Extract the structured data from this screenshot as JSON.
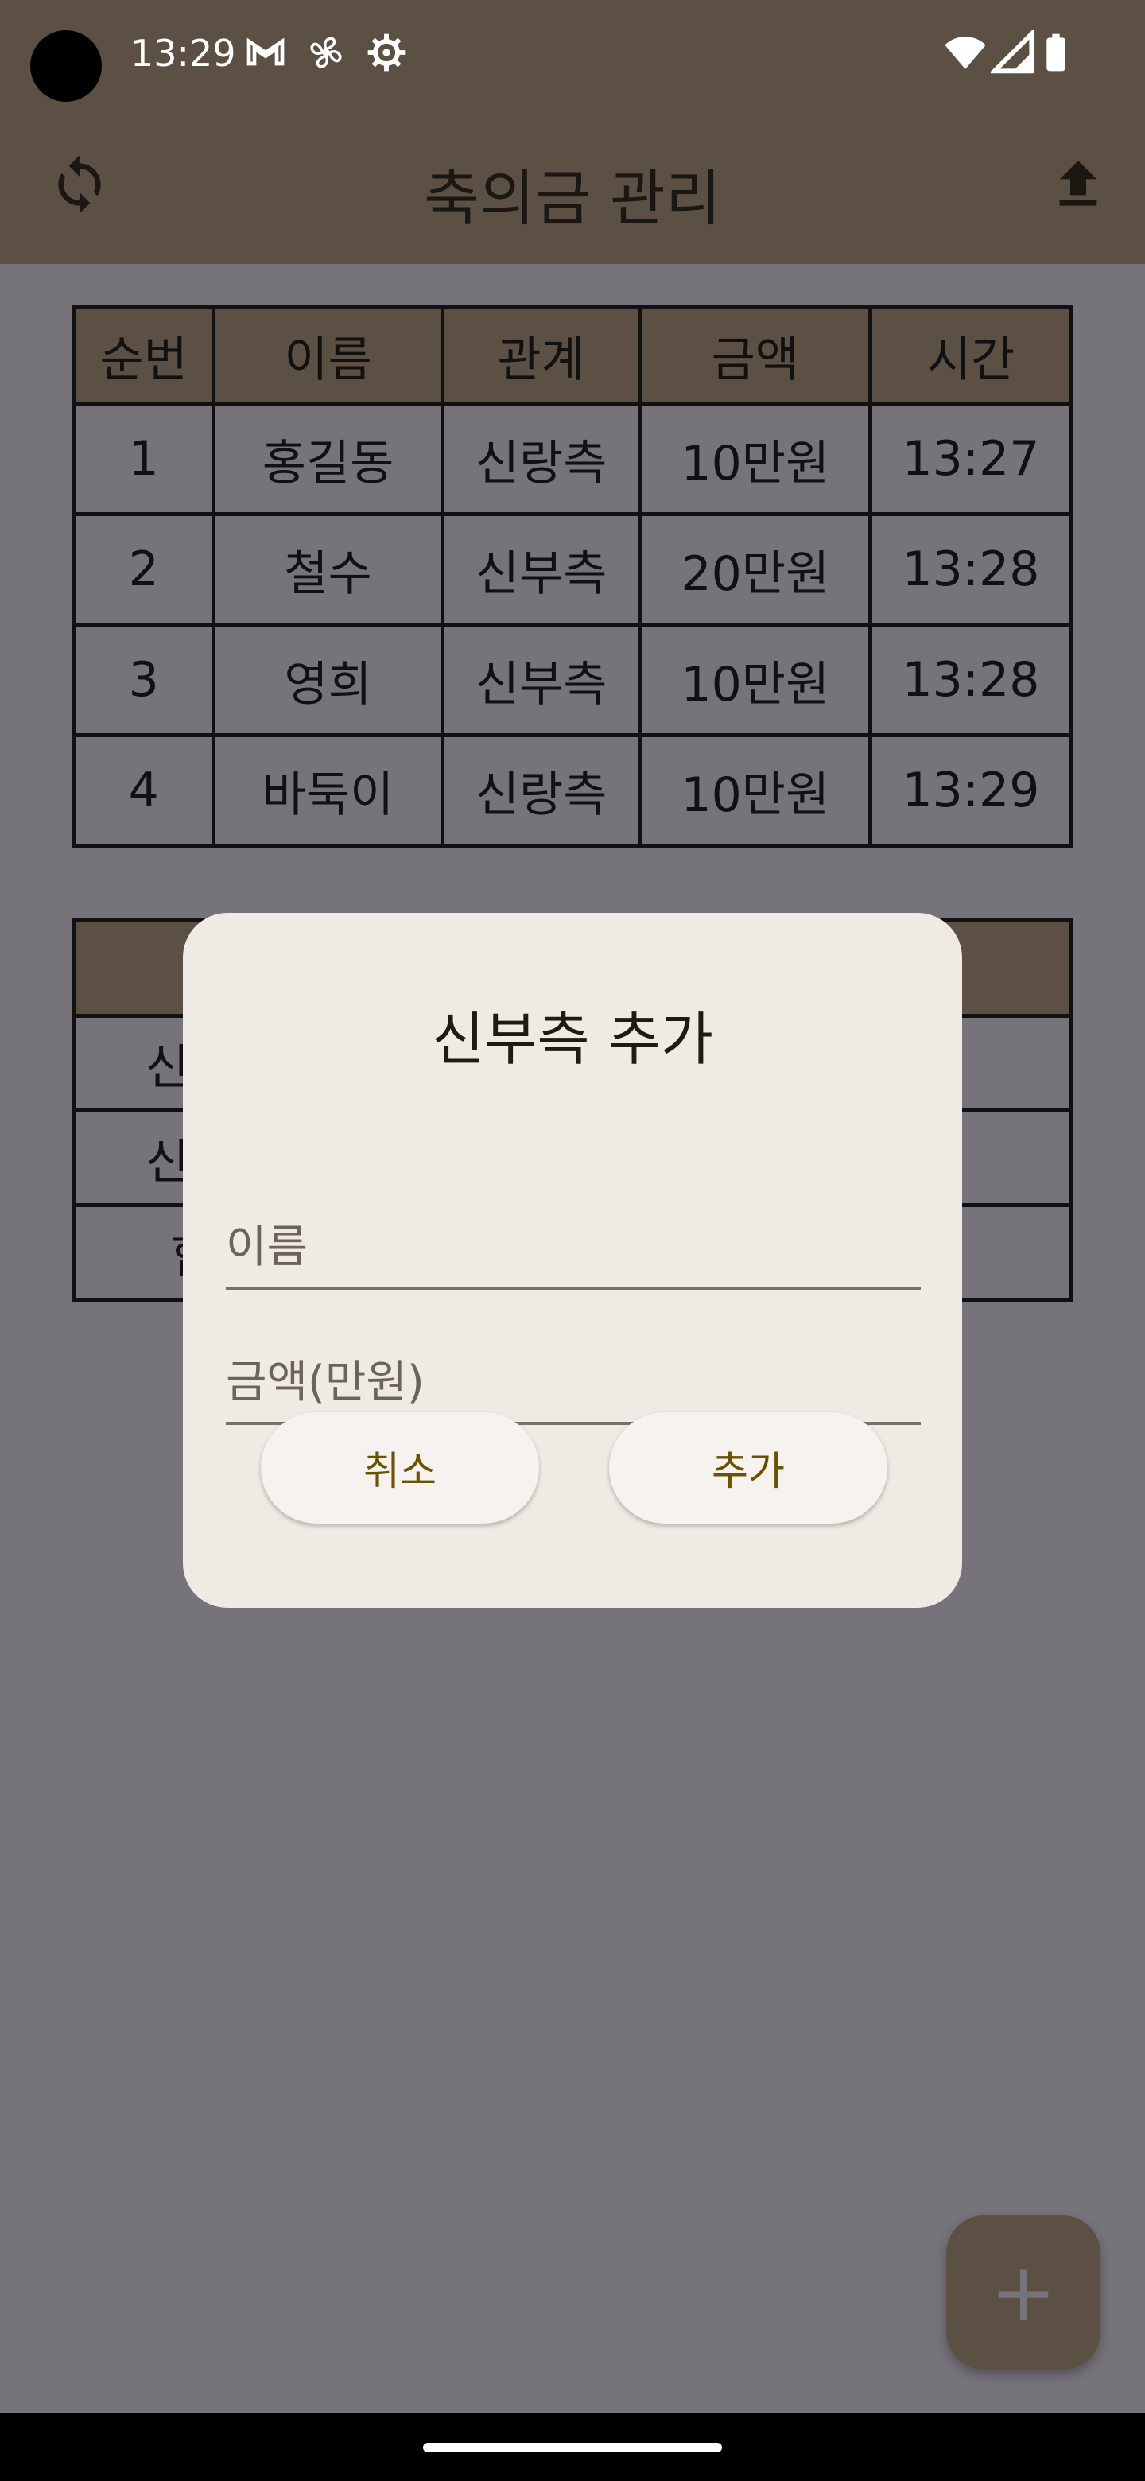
{
  "status_bar": {
    "time": "13:29",
    "left_icons": [
      "gmail-icon",
      "fan-icon",
      "settings-icon"
    ],
    "right_icons": [
      "wifi-icon",
      "cellular-icon",
      "battery-icon"
    ]
  },
  "app_bar": {
    "title": "축의금 관리",
    "left_icon": "refresh-icon",
    "right_icon": "upload-icon"
  },
  "guest_table": {
    "headers": [
      "순번",
      "이름",
      "관계",
      "금액",
      "시간"
    ],
    "rows": [
      [
        "1",
        "홍길동",
        "신랑측",
        "10만원",
        "13:27"
      ],
      [
        "2",
        "철수",
        "신부측",
        "20만원",
        "13:28"
      ],
      [
        "3",
        "영희",
        "신부측",
        "10만원",
        "13:28"
      ],
      [
        "4",
        "바둑이",
        "신랑측",
        "10만원",
        "13:29"
      ]
    ]
  },
  "summary_table_partial": {
    "rows": [
      "신",
      "신",
      "합"
    ]
  },
  "dialog": {
    "title": "신부측 추가",
    "name_placeholder": "이름",
    "amount_placeholder": "금액(만원)",
    "cancel_label": "취소",
    "add_label": "추가"
  },
  "fab": {
    "label": "+",
    "icon": "add-icon"
  },
  "colors": {
    "brand": "#5c5044",
    "dialog_bg": "#efeae4",
    "button_text": "#6a5300",
    "scrim": "#76737a"
  }
}
